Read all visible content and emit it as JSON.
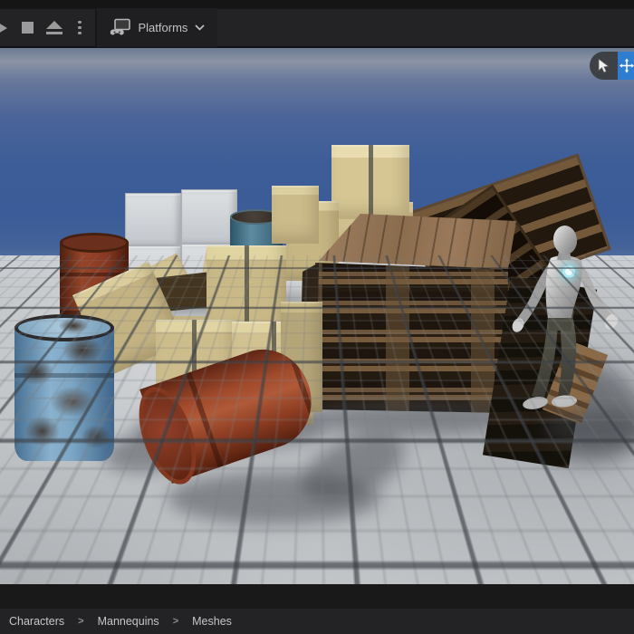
{
  "toolbar": {
    "transport": {
      "play_icon": "play",
      "stop_icon": "stop",
      "eject_icon": "eject",
      "more_icon": "kebab-menu"
    },
    "platforms": {
      "label": "Platforms",
      "icon": "platforms-device-icon",
      "chevron": "chevron-down"
    }
  },
  "viewport": {
    "tools": {
      "select": "cursor-arrow",
      "move": "move-arrows",
      "active_tool": "move",
      "accent_color": "#2e7dd1"
    },
    "scene": {
      "objects": [
        {
          "name": "concrete-block-stack"
        },
        {
          "name": "red-barrel-upright"
        },
        {
          "name": "teal-barrel"
        },
        {
          "name": "cardboard-box-open"
        },
        {
          "name": "cardboard-box-pile"
        },
        {
          "name": "cardboard-box-tower"
        },
        {
          "name": "wooden-pallet-stack"
        },
        {
          "name": "leaning-pallets"
        },
        {
          "name": "mannequin"
        },
        {
          "name": "blue-barrel"
        },
        {
          "name": "red-barrel-lying"
        }
      ]
    }
  },
  "breadcrumb": {
    "items": [
      "Characters",
      "Mannequins",
      "Meshes"
    ],
    "separator": ">"
  },
  "colors": {
    "toolbar_bg": "#232325",
    "sky_deep": "#3b5c98",
    "floor": "#c4c7ca",
    "accent_blue": "#2e7dd1",
    "text": "#c6c6c6"
  }
}
